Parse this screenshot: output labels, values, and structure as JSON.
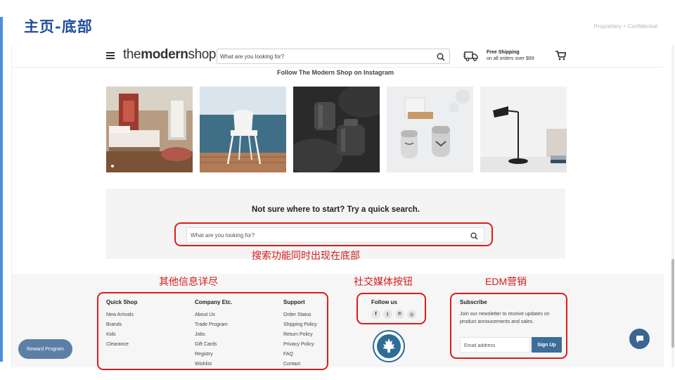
{
  "slide": {
    "title": "主页-底部",
    "confidential": "Proprietary + Confidential",
    "accent_color": "#4a90e2"
  },
  "header": {
    "logo_light_1": "the",
    "logo_bold": "modern",
    "logo_light_2": "shop",
    "search_placeholder": "What are you looking for?",
    "shipping_title": "Free Shipping",
    "shipping_sub": "on all orders over $99",
    "menu_icon": "hamburger-icon",
    "cart_icon": "cart-icon",
    "truck_icon": "truck-icon"
  },
  "instagram": {
    "title": "Follow The Modern Shop on Instagram",
    "tiles": [
      "bedroom-with-red-wall-photo",
      "white-chair-by-the-sea-photo",
      "black-canisters-on-fur-photo",
      "salt-pepper-shakers-photo",
      "black-desk-lamp-photo"
    ]
  },
  "quick_search": {
    "title": "Not sure where to start? Try a quick search.",
    "placeholder": "What are you looking for?"
  },
  "footer": {
    "columns": [
      {
        "heading": "Quick Shop",
        "links": [
          "New Arrivals",
          "Brands",
          "Kids",
          "Clearance"
        ]
      },
      {
        "heading": "Company Etc.",
        "links": [
          "About Us",
          "Trade Program",
          "Jobs",
          "Gift Cards",
          "Registry",
          "Wishlist"
        ]
      },
      {
        "heading": "Support",
        "links": [
          "Order Status",
          "Shipping Policy",
          "Return Policy",
          "Privacy Policy",
          "FAQ",
          "Contact"
        ]
      }
    ],
    "social": {
      "heading": "Follow us",
      "icons": [
        {
          "name": "facebook-icon",
          "glyph": "f"
        },
        {
          "name": "twitter-icon",
          "glyph": "𝕥"
        },
        {
          "name": "pinterest-icon",
          "glyph": "℗"
        },
        {
          "name": "instagram-icon",
          "glyph": "◎"
        }
      ]
    },
    "subscribe": {
      "heading": "Subscribe",
      "text": "Join our newsletter to receive updates on product annoucements and sales.",
      "email_placeholder": "Email address",
      "button": "Sign Up",
      "button_color": "#3b6e99"
    }
  },
  "reward_button": "Reward Program",
  "chat_icon": "chat-bubble-icon",
  "annotations": {
    "search": "搜索功能同时出现在底部",
    "other_info": "其他信息详尽",
    "social": "社交媒体按钮",
    "edm": "EDM营销",
    "color": "#e01b1b"
  }
}
